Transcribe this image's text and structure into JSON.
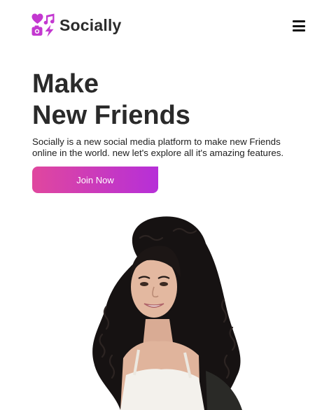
{
  "brand": {
    "name": "Socially",
    "accent_color": "#c338d0",
    "logo_icon": "heart-music-camera-bolt-icon"
  },
  "nav": {
    "menu_icon": "hamburger-menu-icon"
  },
  "hero": {
    "title_line1": "Make",
    "title_line2": "New Friends",
    "description": "Socially is a new social media platform to make new Friends online in the world. new let's explore all it's amazing features.",
    "cta_label": "Join Now",
    "cta_gradient": [
      "#e0479e",
      "#b62fd8"
    ]
  },
  "image": {
    "subject": "portrait-photo"
  }
}
